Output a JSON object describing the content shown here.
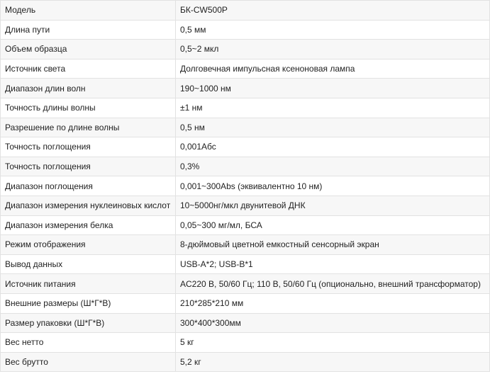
{
  "spec_table": {
    "rows": [
      {
        "label": "Модель",
        "value": "БК-CW500P"
      },
      {
        "label": "Длина пути",
        "value": "0,5 мм"
      },
      {
        "label": "Объем образца",
        "value": "0,5~2 мкл"
      },
      {
        "label": "Источник света",
        "value": "Долговечная импульсная ксеноновая лампа"
      },
      {
        "label": "Диапазон длин волн",
        "value": "190~1000 нм"
      },
      {
        "label": "Точность длины волны",
        "value": "±1 нм"
      },
      {
        "label": "Разрешение по длине волны",
        "value": "0,5 нм"
      },
      {
        "label": "Точность поглощения",
        "value": "0,001Абс"
      },
      {
        "label": "Точность поглощения",
        "value": "0,3%"
      },
      {
        "label": "Диапазон поглощения",
        "value": "0,001~300Abs (эквивалентно 10 нм)"
      },
      {
        "label": "Диапазон измерения нуклеиновых кислот",
        "value": "10~5000нг/мкл двунитевой ДНК"
      },
      {
        "label": "Диапазон измерения белка",
        "value": "0,05~300 мг/мл, БСА"
      },
      {
        "label": "Режим отображения",
        "value": "8-дюймовый цветной емкостный сенсорный экран"
      },
      {
        "label": "Вывод данных",
        "value": "USB-A*2; USB-B*1"
      },
      {
        "label": "Источник питания",
        "value": "AC220 В, 50/60 Гц; 110 В, 50/60 Гц (опционально, внешний трансформатор)"
      },
      {
        "label": "Внешние размеры (Ш*Г*В)",
        "value": "210*285*210 мм"
      },
      {
        "label": "Размер упаковки (Ш*Г*В)",
        "value": "300*400*300мм"
      },
      {
        "label": "Вес нетто",
        "value": "5 кг"
      },
      {
        "label": "Вес брутто",
        "value": "5,2 кг"
      }
    ]
  }
}
